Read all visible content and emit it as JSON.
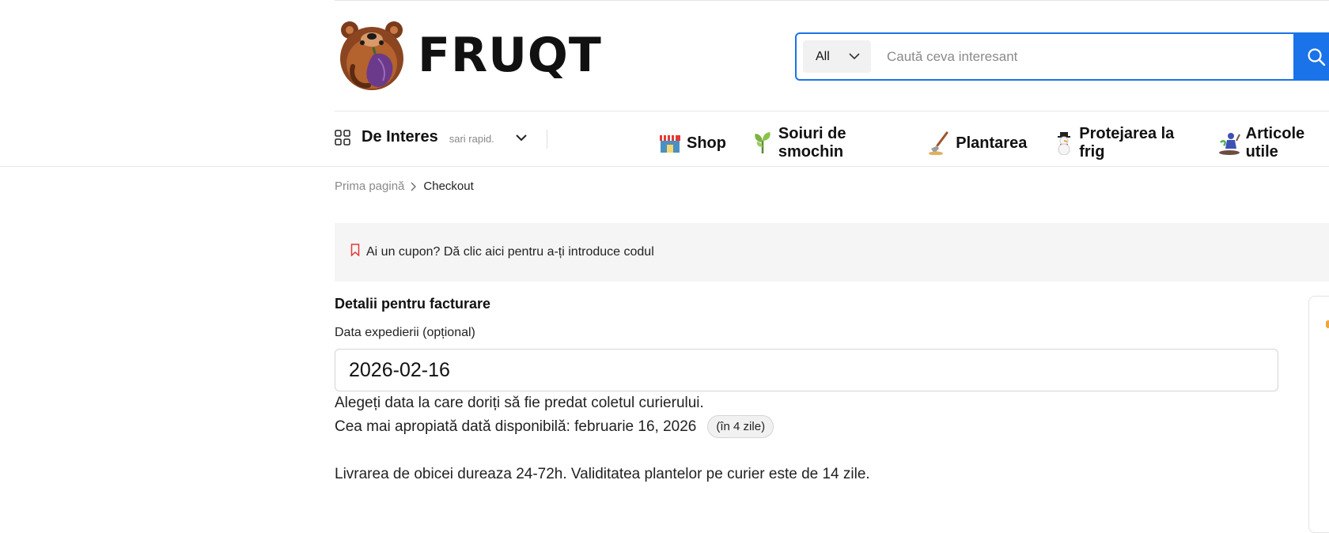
{
  "brand": {
    "name": "FRUQT"
  },
  "search": {
    "category": "All",
    "placeholder": "Caută ceva interesant"
  },
  "nav": {
    "interes": {
      "label": "De Interes",
      "sub": "sari rapid."
    },
    "links": [
      {
        "label": "Shop",
        "icon": "shop-icon"
      },
      {
        "label": "Soiuri de smochin",
        "icon": "sprout-icon"
      },
      {
        "label": "Plantarea",
        "icon": "shovel-icon"
      },
      {
        "label": "Protejarea la frig",
        "icon": "snowman-icon"
      },
      {
        "label": "Articole utile",
        "icon": "gardener-icon"
      }
    ]
  },
  "breadcrumb": {
    "home": "Prima pagină",
    "current": "Checkout"
  },
  "coupon": {
    "text": "Ai un cupon? Dă clic aici pentru a-ți introduce codul"
  },
  "billing": {
    "title": "Detalii pentru facturare",
    "date_label": "Data expedierii (opțional)",
    "date_value": "2026-02-16",
    "help": "Alegeți data la care doriți să fie predat coletul curierului.",
    "nearest": "Cea mai apropiată dată disponibilă: februarie 16, 2026",
    "badge": "(în 4 zile)",
    "delivery": "Livrarea de obicei dureaza 24-72h. Validitatea plantelor pe curier este de 14 zile."
  },
  "colors": {
    "accent": "#1a73e8",
    "coupon_icon": "#e53935"
  }
}
